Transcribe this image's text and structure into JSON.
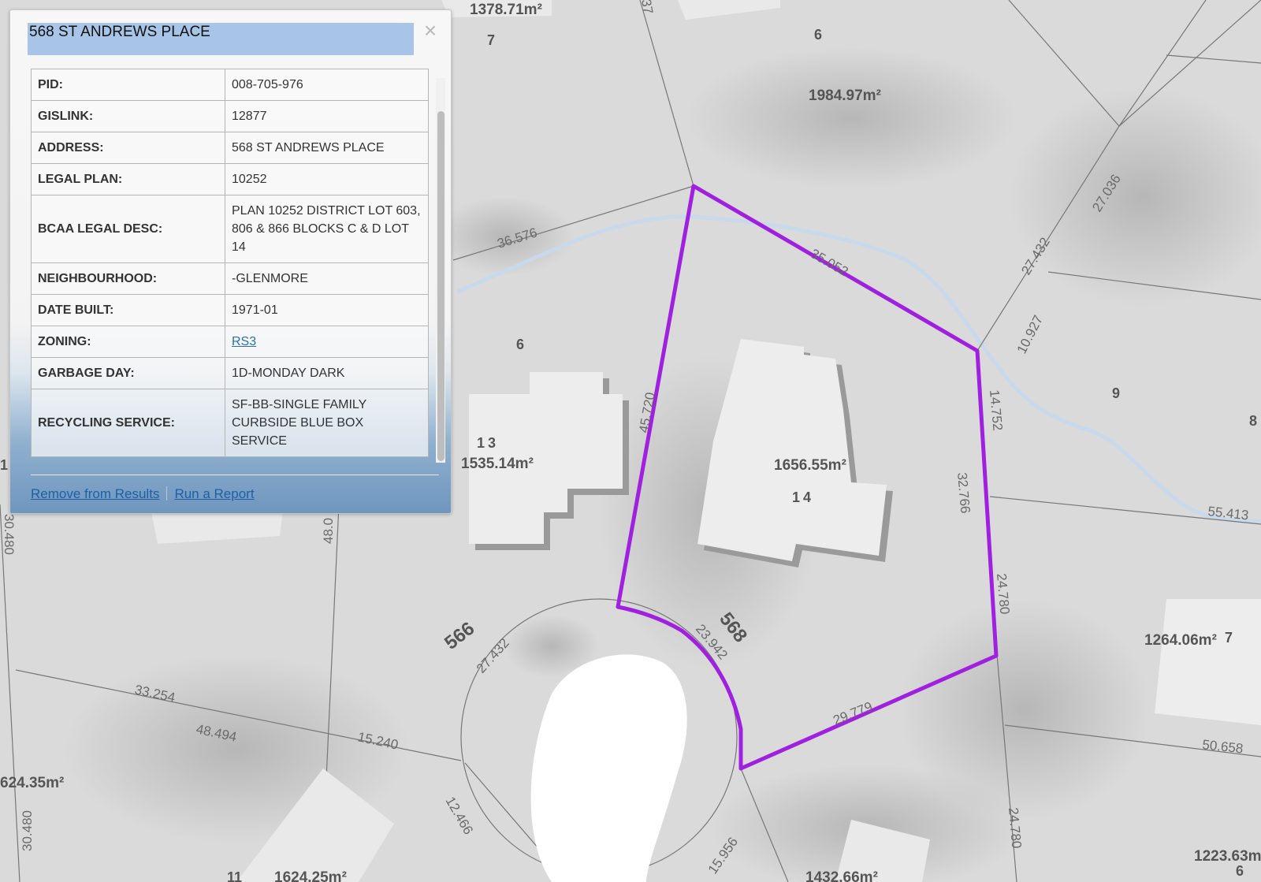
{
  "popup": {
    "title": "568 ST ANDREWS PLACE",
    "close_label": "×",
    "rows": [
      {
        "label": "PID:",
        "value": "008-705-976"
      },
      {
        "label": "GISLINK:",
        "value": "12877"
      },
      {
        "label": "ADDRESS:",
        "value": "568 ST ANDREWS PLACE"
      },
      {
        "label": "LEGAL PLAN:",
        "value": "10252"
      },
      {
        "label": "BCAA LEGAL DESC:",
        "value": "PLAN 10252 DISTRICT LOT 603, 806 & 866  BLOCKS C & D LOT 14"
      },
      {
        "label": "NEIGHBOURHOOD:",
        "value": "-GLENMORE"
      },
      {
        "label": "DATE BUILT:",
        "value": "1971-01"
      },
      {
        "label": "ZONING:",
        "value": "RS3",
        "link": true
      },
      {
        "label": "GARBAGE DAY:",
        "value": "1D-MONDAY DARK"
      },
      {
        "label": "RECYCLING SERVICE:",
        "value": "SF-BB-SINGLE FAMILY CURBSIDE BLUE BOX SERVICE"
      }
    ],
    "remove_link": "Remove from Results",
    "report_link": "Run a Report"
  },
  "map": {
    "highlight_color": "#a020e0",
    "lot_numbers": [
      "7",
      "6",
      "6",
      "13",
      "14",
      "9",
      "8",
      "7",
      "6",
      "11",
      "1"
    ],
    "areas": [
      "1378.71m²",
      "1984.97m²",
      "1535.14m²",
      "1656.55m²",
      "1264.06m²",
      "1223.63m",
      "624.35m²",
      "1624.25m²",
      "1432.66m²"
    ],
    "house_numbers": [
      "568",
      "566"
    ],
    "dimensions": [
      "36.576",
      "35.052",
      "27.036",
      "27.432",
      "10.927",
      "14.752",
      "45.720",
      "32.766",
      "55.413",
      "24.780",
      "23.942",
      "27.432",
      "33.254",
      "48.494",
      "15.240",
      "29.779",
      "50.658",
      "12.466",
      "15.956",
      "24.780",
      "30.480",
      "48.0",
      "30.480",
      "37"
    ]
  }
}
